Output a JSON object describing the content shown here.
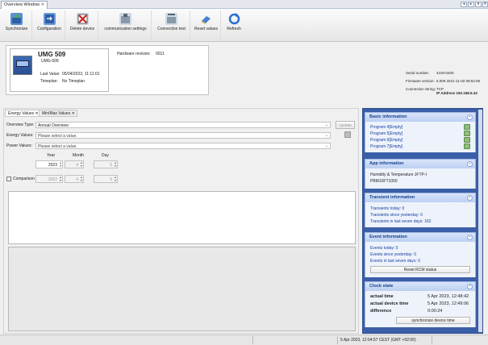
{
  "tabs": [
    {
      "label": "Overview Window"
    }
  ],
  "toolbar": {
    "synchronize": "Synchronize",
    "configuration": "Configuration",
    "delete_device": "Delete device",
    "communication_settings": "communication settings",
    "connection_test": "Connection test",
    "reset_values": "Reset values",
    "refresh": "Refresh"
  },
  "device": {
    "name": "UMG 509",
    "model": "UMG-509",
    "last_value_label": "Last Value:",
    "last_value": "05/04/2023, 11:11:01",
    "timeplan_label": "Timeplan:",
    "timeplan": "No Timeplan",
    "hardware_revision_label": "Hardware revision:",
    "hardware_revision": "0011",
    "serial_number_label": "Serial number:",
    "serial_number": "4100-0400",
    "firmware_version_label": "Firmware version:",
    "firmware_version": "5.009 2021-11-02 09:52:09",
    "connection_string_label": "Connection String:",
    "connection_string_1": "TCP",
    "connection_string_2": "IP Address 192.168.5.34"
  },
  "subtabs": [
    {
      "label": "Energy Values"
    },
    {
      "label": "Min/Max Values"
    }
  ],
  "form": {
    "overview_type_label": "Overview Type:",
    "overview_type": "Annual Overview",
    "energy_values_label": "Energy Values:",
    "energy_values_placeholder": "Please select a value.",
    "power_values_label": "Power Values:",
    "power_values_placeholder": "Please select a value.",
    "update_button": "Update",
    "year_label": "Year",
    "month_label": "Month",
    "day_label": "Day",
    "year": "2023",
    "month": "4",
    "day": "5",
    "comparison_label": "Comparison",
    "comp_year": "2022",
    "comp_month": "4",
    "comp_day": "5"
  },
  "basic_info": {
    "title": "Basic information",
    "programs": [
      "Program 4[Empty]",
      "Program 5[Empty]",
      "Program 6[Empty]",
      "Program 7[Empty]"
    ]
  },
  "app_info": {
    "title": "App information",
    "line1": "Humidity & Temperature JFTP-I",
    "line2": "PBM10FT1000"
  },
  "transient_info": {
    "title": "Transient information",
    "today": "Transients today: 0",
    "since_yesterday": "Transients since yesterday: 0",
    "last_seven": "Transients in last seven days: 162"
  },
  "event_info": {
    "title": "Event information",
    "today": "Events today: 0",
    "since_yesterday": "Events since yesterday: 0",
    "last_seven": "Events in last seven days: 0",
    "reset_button": "Reset RCM status"
  },
  "clock": {
    "title": "Clock state",
    "actual_time_label": "actual time",
    "actual_time": "5 Apr 2023, 12:48:42",
    "actual_device_time_label": "actual device time",
    "actual_device_time": "5 Apr 2023, 12:49:06",
    "difference_label": "difference",
    "difference": "0:00:24",
    "sync_button": "synchronize device time"
  },
  "status": {
    "datetime": "5 Apr 2023, 12:04:57 CEST (GMT +02:00)"
  },
  "colors": {
    "panel_bg": "#3b5ea8",
    "panel_header": "#15428b",
    "link": "#1840a0"
  }
}
